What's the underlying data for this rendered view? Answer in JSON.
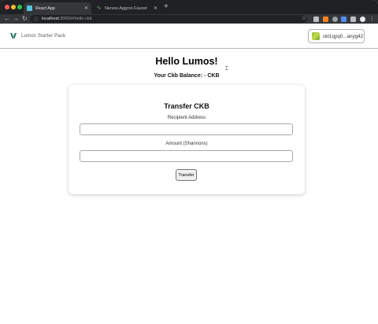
{
  "browser": {
    "tabs": [
      {
        "title": "React App",
        "active": true
      },
      {
        "title": "Nervos Aggron Faucet",
        "active": false
      }
    ],
    "url": {
      "host": "localhost",
      "rest": ":3000/#/hello-ckb"
    }
  },
  "page": {
    "brand": "Lumos Starter Pack",
    "wallet_address": "ckt1qyq0...anyg42",
    "heading": "Hello Lumos!",
    "balance_text": "Your Ckb Balance: - CKB",
    "transfer": {
      "title": "Transfer CKB",
      "recipient_label": "Recipient Address",
      "recipient_value": "",
      "amount_label": "Amount (Shannons)",
      "amount_value": "",
      "button_label": "Transfer"
    }
  },
  "colors": {
    "chrome_dark": "#202124",
    "toolbar": "#35363a",
    "accent_logo": "#1b6b5a",
    "page_bg": "#ffffff"
  },
  "icons": [
    "back-icon",
    "forward-icon",
    "reload-icon",
    "info-icon",
    "star-icon",
    "lumos-logo-icon",
    "wallet-avatar-icon"
  ]
}
